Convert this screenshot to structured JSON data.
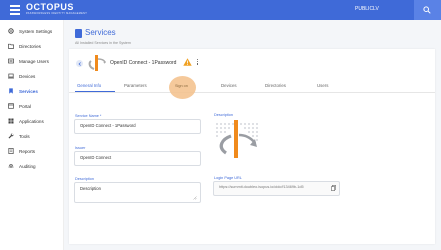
{
  "header": {
    "brand": "OCTOPUS",
    "tagline": "PASSWORDLESS IDENTITY MANAGEMENT",
    "user_label": "PUBLICLV",
    "icons": {
      "menu": "hamburger-icon",
      "search": "search-icon"
    }
  },
  "sidebar": {
    "items": [
      {
        "label": "System Settings",
        "icon": "gear-icon",
        "active": false
      },
      {
        "label": "Directories",
        "icon": "folder-icon",
        "active": false
      },
      {
        "label": "Manage Users",
        "icon": "users-icon",
        "active": false
      },
      {
        "label": "Devices",
        "icon": "laptop-icon",
        "active": false
      },
      {
        "label": "Services",
        "icon": "bookmark-icon",
        "active": true
      },
      {
        "label": "Portal",
        "icon": "window-icon",
        "active": false
      },
      {
        "label": "Applications",
        "icon": "grid-icon",
        "active": false
      },
      {
        "label": "Tools",
        "icon": "wrench-icon",
        "active": false
      },
      {
        "label": "Reports",
        "icon": "report-icon",
        "active": false
      },
      {
        "label": "Auditing",
        "icon": "fingerprint-icon",
        "active": false
      }
    ]
  },
  "page": {
    "title": "Services",
    "subtitle": "All Installed Services in the System"
  },
  "service": {
    "name": "OpenID Connect - 1Password"
  },
  "tabs": [
    {
      "label": "General Info",
      "active": true
    },
    {
      "label": "Parameters",
      "active": false
    },
    {
      "label": "Sign on",
      "active": false
    },
    {
      "label": "Devices",
      "active": false
    },
    {
      "label": "Directories",
      "active": false
    },
    {
      "label": "Users",
      "active": false
    }
  ],
  "form": {
    "service_name_label": "Service Name *",
    "service_name_value": "OpenID Connect - 1Password",
    "issuer_label": "Issuer",
    "issuer_value": "OpenID Connect",
    "description_label": "Description",
    "description_placeholder": "Description",
    "description_value": "Description",
    "logo_label": "Description",
    "login_url_label": "Login Page URL",
    "login_url_value": "https://summit.doubleo.isopus.io/oidc/f13469b-1d5"
  },
  "colors": {
    "accent": "#3f6ad8",
    "warning": "#f0a020",
    "ripple": "#f3c08a",
    "logo_orange": "#f08a1c"
  }
}
